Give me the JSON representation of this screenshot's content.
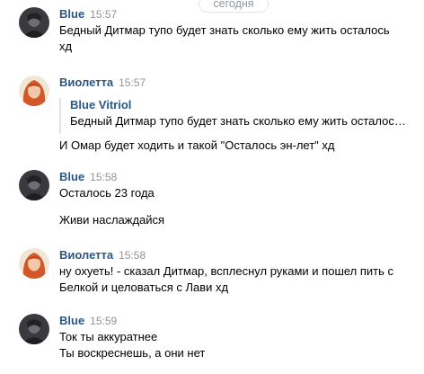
{
  "date_separator": "сегодня",
  "messages": [
    {
      "author": "Blue",
      "time": "15:57",
      "lines": [
        "Бедный Дитмар тупо будет знать сколько ему жить осталось",
        "хд"
      ]
    },
    {
      "author": "Виолетта",
      "time": "15:57",
      "quote": {
        "author": "Blue Vitriol",
        "text": "Бедный Дитмар тупо будет знать сколько ему жить осталось хд"
      },
      "lines": [
        "И Омар будет ходить и такой \"Осталось эн-лет\" хд"
      ]
    },
    {
      "author": "Blue",
      "time": "15:58",
      "lines": [
        "Осталось 23 года",
        "Живи наслаждайся"
      ]
    },
    {
      "author": "Виолетта",
      "time": "15:58",
      "lines": [
        "ну охуеть! - сказал Дитмар, всплеснул руками и пошел пить с",
        "Белкой и целоваться с Лави хд"
      ]
    },
    {
      "author": "Blue",
      "time": "15:59",
      "lines": [
        "Ток ты аккуратнее",
        "Ты воскреснешь, а они нет"
      ]
    }
  ]
}
